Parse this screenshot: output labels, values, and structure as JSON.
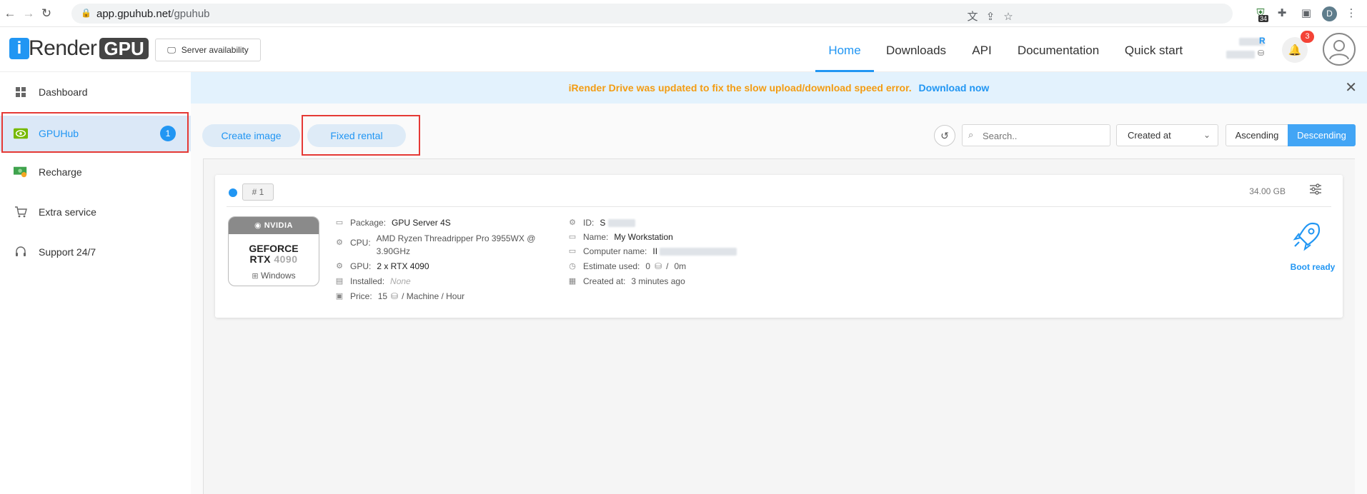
{
  "browser": {
    "url_host": "app.gpuhub.net",
    "url_path": "/gpuhub",
    "ext_badge": "34",
    "profile_initial": "D"
  },
  "header": {
    "logo_i": "i",
    "logo_text": "Render",
    "logo_gpu": "GPU",
    "server_button": "Server availability",
    "nav": [
      "Home",
      "Downloads",
      "API",
      "Documentation",
      "Quick start"
    ],
    "notifications": "3"
  },
  "sidebar": {
    "items": [
      {
        "label": "Dashboard",
        "icon": "dashboard-icon"
      },
      {
        "label": "GPUHub",
        "icon": "nvidia-icon",
        "badge": "1"
      },
      {
        "label": "Recharge",
        "icon": "money-icon"
      },
      {
        "label": "Extra service",
        "icon": "cart-icon"
      },
      {
        "label": "Support 24/7",
        "icon": "headset-icon"
      }
    ]
  },
  "banner": {
    "message": "iRender Drive was updated to fix the slow upload/download speed error.",
    "link": "Download now"
  },
  "toolbar": {
    "create_image": "Create image",
    "fixed_rental": "Fixed rental",
    "search_placeholder": "Search..",
    "sort_field": "Created at",
    "ascending": "Ascending",
    "descending": "Descending"
  },
  "machine": {
    "number": "# 1",
    "storage": "34.00 GB",
    "gpu_brand": "NVIDIA",
    "gpu_line1": "GEFORCE",
    "gpu_line2_a": "RTX ",
    "gpu_line2_b": "4090",
    "os": "Windows",
    "package_label": "Package:",
    "package": "GPU Server 4S",
    "cpu_label": "CPU:",
    "cpu_1": "AMD Ryzen Threadripper Pro 3955WX @",
    "cpu_2": "3.90GHz",
    "gpu_label": "GPU:",
    "gpu": "2 x RTX 4090",
    "installed_label": "Installed:",
    "installed": "None",
    "price_label": "Price:",
    "price_value": "15",
    "price_unit": "/ Machine / Hour",
    "id_label": "ID:",
    "id": "S",
    "name_label": "Name:",
    "name": "My Workstation",
    "computer_label": "Computer name:",
    "computer": "II",
    "estimate_label": "Estimate used:",
    "estimate_coins": "0",
    "estimate_sep": "/",
    "estimate_time": "0m",
    "created_label": "Created at:",
    "created": "3 minutes ago",
    "status": "Boot ready"
  },
  "colors": {
    "accent": "#2196f3",
    "warning": "#f39c12",
    "highlight_box": "#e53935"
  }
}
